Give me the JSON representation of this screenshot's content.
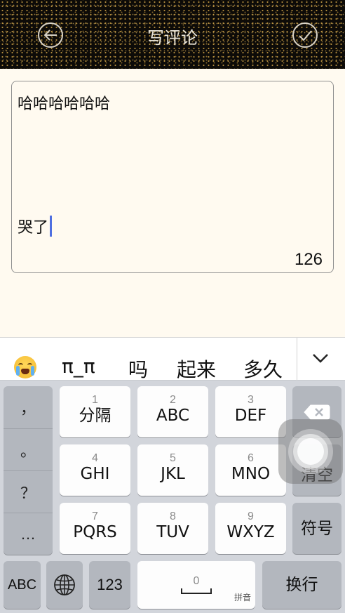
{
  "header": {
    "title": "写评论",
    "back_icon": "arrow-left-icon",
    "confirm_icon": "checkmark-icon"
  },
  "editor": {
    "line1": "哈哈哈哈哈哈",
    "line2": "哭了",
    "remaining_count": "126"
  },
  "candidates": {
    "emoji": "crying-face-emoji",
    "items": [
      "π_π",
      "吗",
      "起来",
      "多久"
    ],
    "expand_icon": "chevron-down-icon"
  },
  "keyboard": {
    "punctuation": [
      "，",
      "。",
      "？",
      "…"
    ],
    "keys": [
      {
        "num": "1",
        "label": "分隔"
      },
      {
        "num": "2",
        "label": "ABC"
      },
      {
        "num": "3",
        "label": "DEF"
      },
      {
        "num": "4",
        "label": "GHI"
      },
      {
        "num": "5",
        "label": "JKL"
      },
      {
        "num": "6",
        "label": "MNO"
      },
      {
        "num": "7",
        "label": "PQRS"
      },
      {
        "num": "8",
        "label": "TUV"
      },
      {
        "num": "9",
        "label": "WXYZ"
      }
    ],
    "clear_label": "清空",
    "symbol_label": "符号",
    "abc_label": "ABC",
    "num_mode_label": "123",
    "space_num": "0",
    "space_hint": "拼音",
    "return_label": "换行",
    "colors": {
      "key_bg": "#fdfdfd",
      "dark_key_bg": "#b3b7be",
      "keyboard_bg": "#d2d5db",
      "caret": "#4f6fe0"
    }
  }
}
